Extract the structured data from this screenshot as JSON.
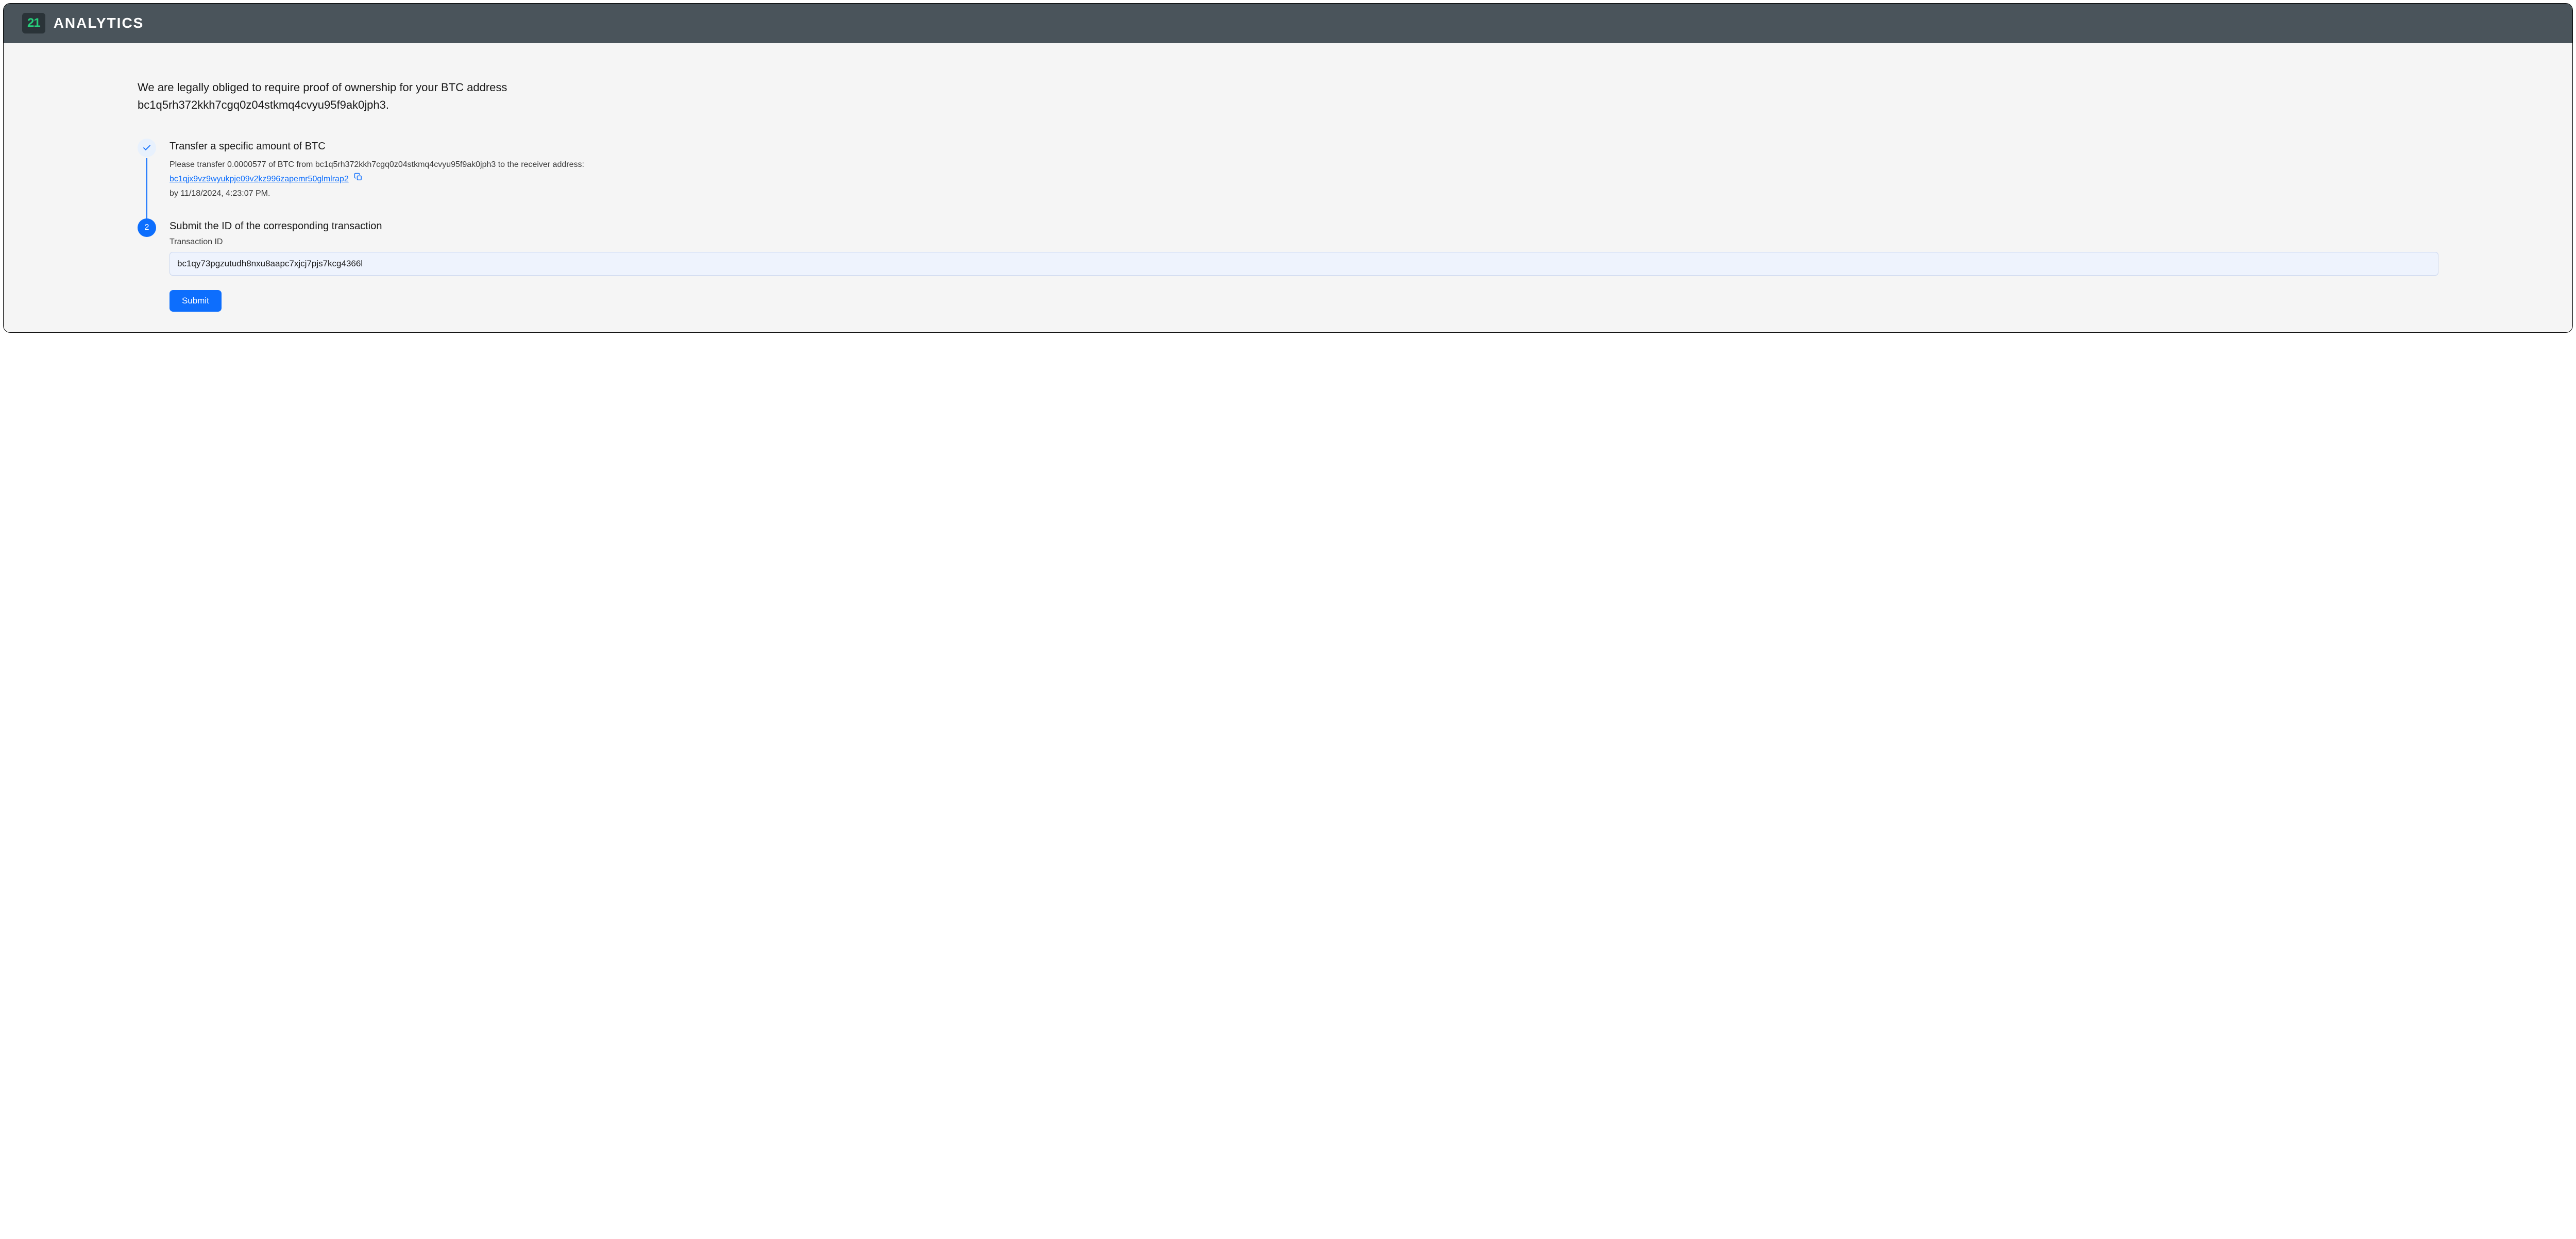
{
  "brand": {
    "logo_number": "21",
    "name": "ANALYTICS"
  },
  "intro": {
    "line1": "We are legally obliged to require proof of ownership for your BTC address",
    "line2_address": "bc1q5rh372kkh7cgq0z04stkmq4cvyu95f9ak0jph3",
    "line2_suffix": "."
  },
  "steps": {
    "1": {
      "title": "Transfer a specific amount of BTC",
      "desc_prefix": "Please transfer 0.0000577 of BTC from bc1q5rh372kkh7cgq0z04stkmq4cvyu95f9ak0jph3 to the receiver address:",
      "receiver_address": "bc1qjx9vz9wyukpje09v2kz996zapemr50glmlrap2",
      "deadline_prefix": "by ",
      "deadline": "11/18/2024, 4:23:07 PM",
      "deadline_suffix": "."
    },
    "2": {
      "number": "2",
      "title": "Submit the ID of the corresponding transaction",
      "field_label": "Transaction ID",
      "input_value": "bc1qy73pgzutudh8nxu8aapc7xjcj7pjs7kcg4366l"
    }
  },
  "actions": {
    "submit_label": "Submit"
  }
}
